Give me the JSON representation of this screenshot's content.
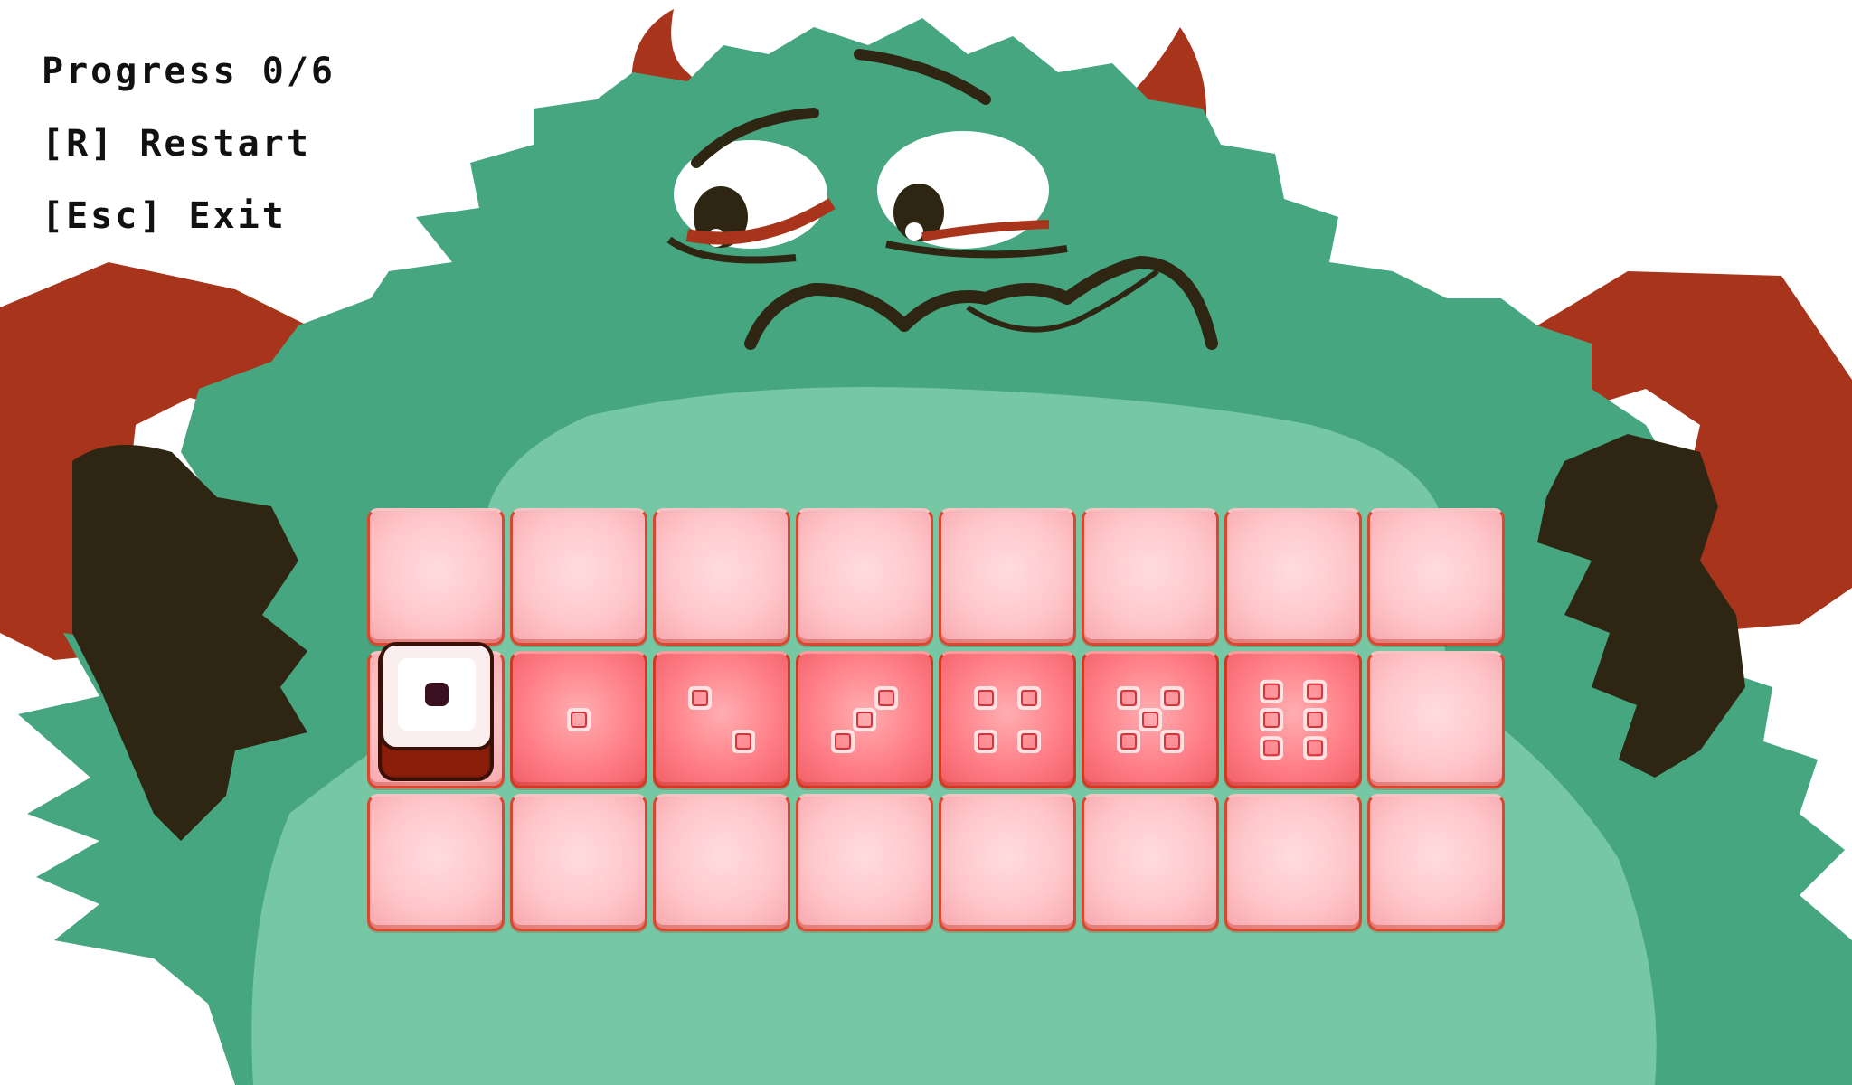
{
  "hud": {
    "progress_label": "Progress 0/6",
    "restart_label": "[R] Restart",
    "exit_label": "[Esc] Exit"
  },
  "progress": {
    "current": 0,
    "total": 6
  },
  "board": {
    "rows": 3,
    "cols": 8,
    "cells": [
      [
        0,
        0,
        0,
        0,
        0,
        0,
        0,
        0
      ],
      [
        -1,
        1,
        2,
        3,
        4,
        5,
        6,
        0
      ],
      [
        0,
        0,
        0,
        0,
        0,
        0,
        0,
        0
      ]
    ]
  },
  "player_die": {
    "row": 1,
    "col": 0,
    "face": 1
  },
  "colors": {
    "tile_light": "#ffc7cb",
    "tile_active": "#ff8088",
    "tile_border": "#d9472f",
    "monster_green": "#45a680",
    "monster_belly": "#76c7a3",
    "monster_red": "#a8351b",
    "monster_dark": "#2e2612",
    "die_face": "#fbeeee",
    "die_side": "#8b1e0a",
    "pip": "#3a1020"
  }
}
